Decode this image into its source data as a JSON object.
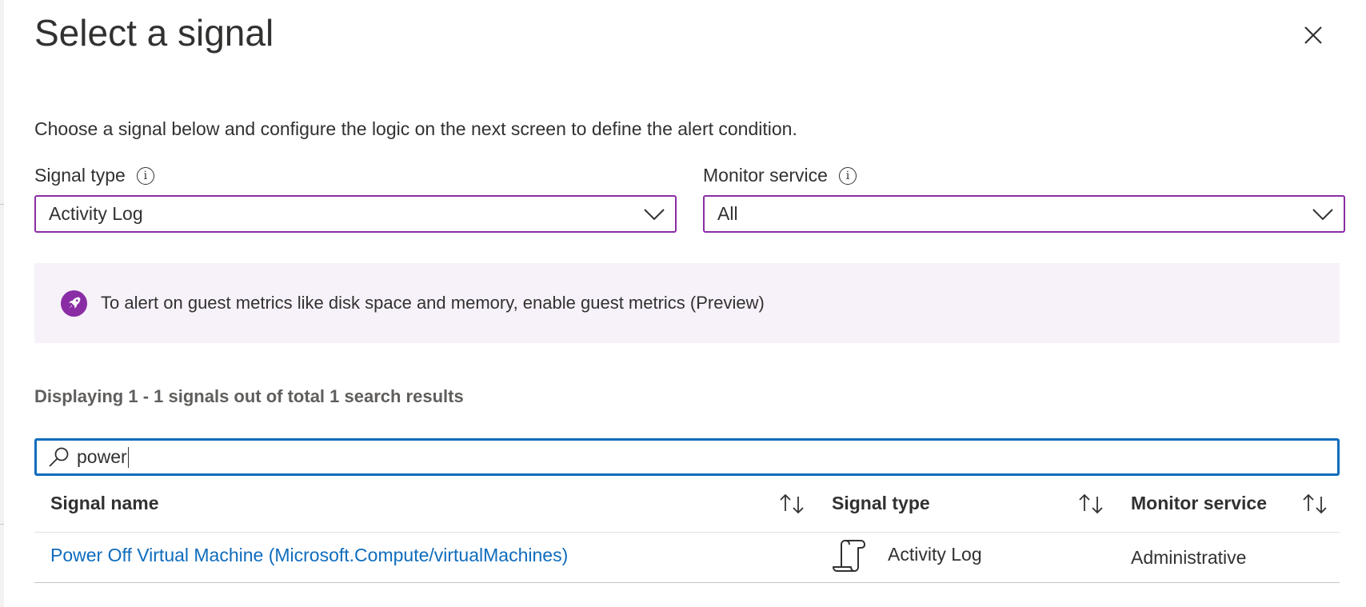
{
  "dialog": {
    "title": "Select a signal",
    "description": "Choose a signal below and configure the logic on the next screen to define the alert condition."
  },
  "filters": {
    "signal_type": {
      "label": "Signal type",
      "value": "Activity Log"
    },
    "monitor_service": {
      "label": "Monitor service",
      "value": "All"
    }
  },
  "banner": {
    "text": "To alert on guest metrics like disk space and memory, enable guest metrics (Preview)"
  },
  "results_summary": "Displaying 1 - 1 signals out of total 1 search results",
  "search": {
    "value": "power"
  },
  "table": {
    "columns": [
      "Signal name",
      "Signal type",
      "Monitor service"
    ],
    "rows": [
      {
        "signal_name": "Power Off Virtual Machine (Microsoft.Compute/virtualMachines)",
        "signal_type": "Activity Log",
        "monitor_service": "Administrative"
      }
    ]
  },
  "colors": {
    "accent": "#8a2da5",
    "focus": "#0f6cbd",
    "link": "#0f6cbd",
    "banner_bg": "#f7f2f9"
  },
  "icons": [
    "close-icon",
    "info-icon",
    "chevron-down-icon",
    "rocket-icon",
    "search-icon",
    "sort-icon",
    "activity-log-icon"
  ]
}
